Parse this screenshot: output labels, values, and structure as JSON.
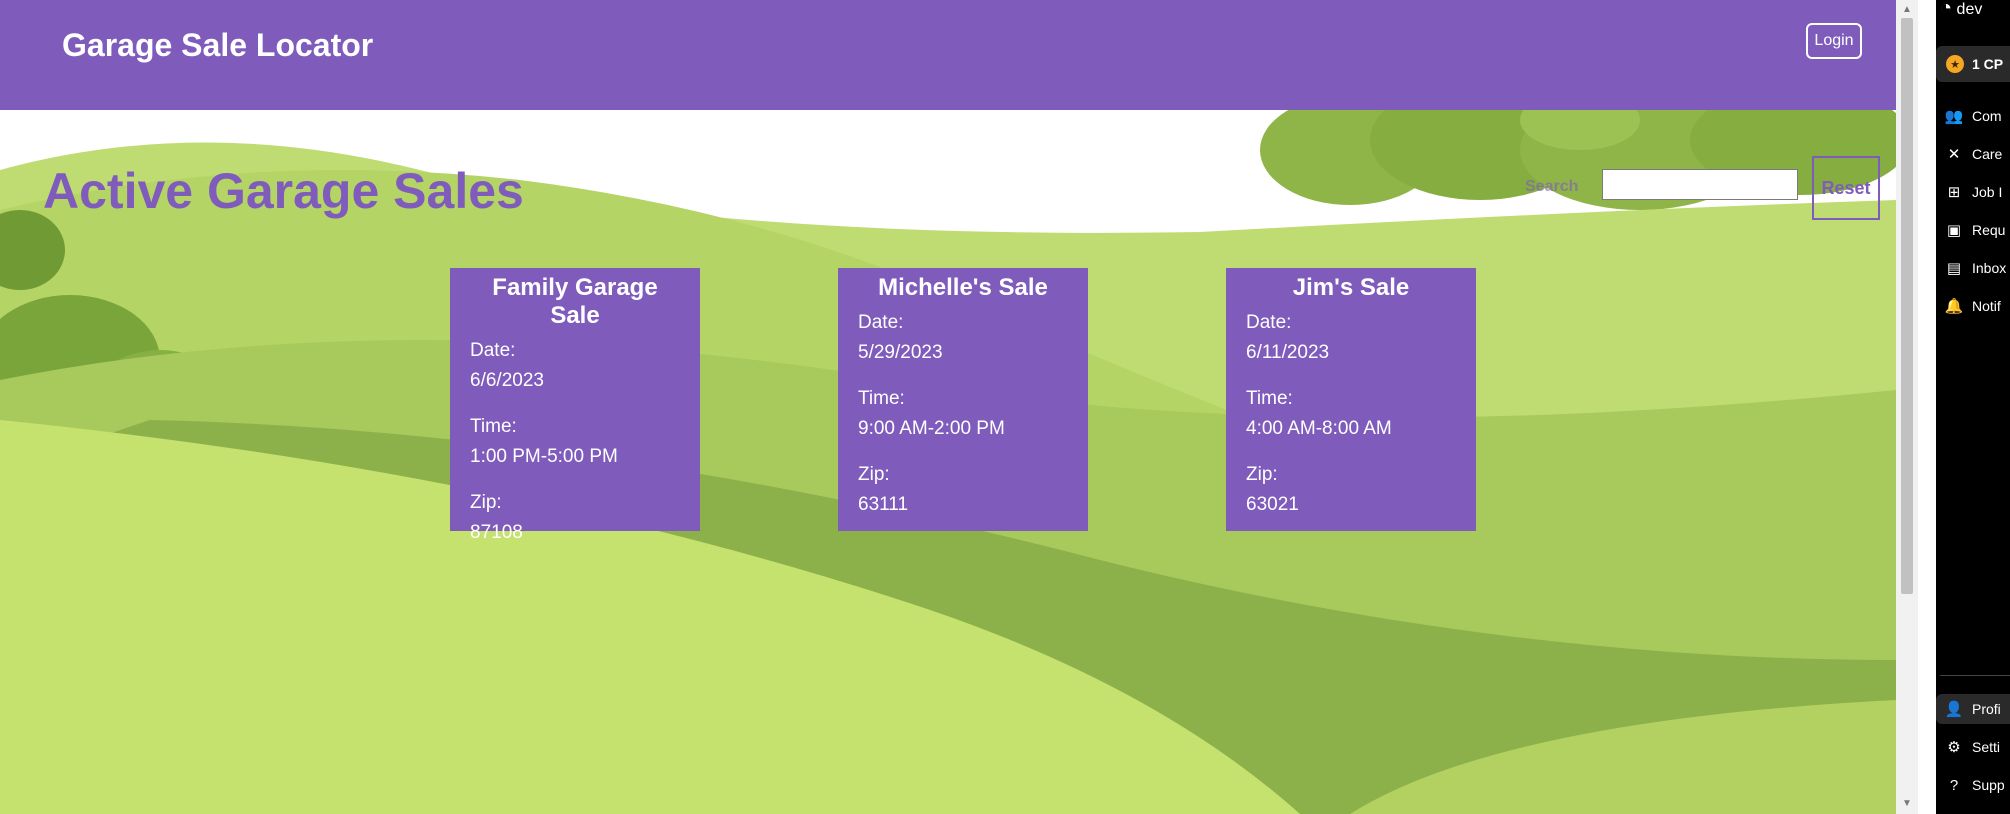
{
  "app": {
    "brand": "Garage Sale Locator",
    "login_label": "Login"
  },
  "colors": {
    "brand_purple": "#7f5cbc",
    "card_text": "#ffffff"
  },
  "main": {
    "page_title": "Active Garage Sales",
    "search_label": "Search",
    "search_value": "",
    "reset_label": "Reset"
  },
  "sales": [
    {
      "title": "Family Garage Sale",
      "date_label": "Date:",
      "date": "6/6/2023",
      "time_label": "Time:",
      "time": "1:00 PM-5:00 PM",
      "zip_label": "Zip:",
      "zip": "87108"
    },
    {
      "title": "Michelle's Sale",
      "date_label": "Date:",
      "date": "5/29/2023",
      "time_label": "Time:",
      "time": "9:00 AM-2:00 PM",
      "zip_label": "Zip:",
      "zip": "63111"
    },
    {
      "title": "Jim's Sale",
      "date_label": "Date:",
      "date": "6/11/2023",
      "time_label": "Time:",
      "time": "4:00 AM-8:00 AM",
      "zip_label": "Zip:",
      "zip": "63021"
    }
  ],
  "side_panel": {
    "logo_text": "dev",
    "cpe_badge": "1 CP",
    "items": [
      {
        "icon": "community-icon",
        "label": "Com"
      },
      {
        "icon": "tools-icon",
        "label": "Care"
      },
      {
        "icon": "grid-icon",
        "label": "Job I"
      },
      {
        "icon": "briefcase-icon",
        "label": "Requ"
      },
      {
        "icon": "inbox-icon",
        "label": "Inbox"
      },
      {
        "icon": "bell-icon",
        "label": "Notif"
      }
    ],
    "bottom_items": [
      {
        "icon": "person-icon",
        "label": "Profi"
      },
      {
        "icon": "gear-icon",
        "label": "Setti"
      },
      {
        "icon": "help-icon",
        "label": "Supp"
      }
    ]
  }
}
